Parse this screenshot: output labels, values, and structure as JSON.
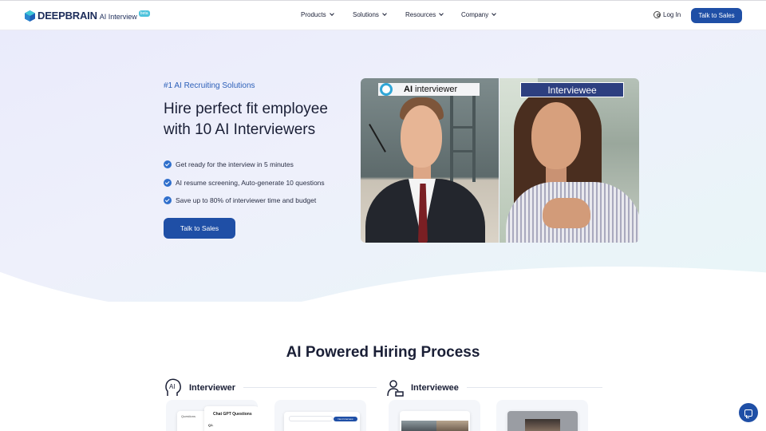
{
  "header": {
    "logo": {
      "brand": "DEEPBRAIN",
      "product": "AI Interview",
      "badge": "beta"
    },
    "nav": [
      {
        "label": "Products"
      },
      {
        "label": "Solutions"
      },
      {
        "label": "Resources"
      },
      {
        "label": "Company"
      }
    ],
    "login_label": "Log In",
    "cta_label": "Talk to Sales"
  },
  "hero": {
    "eyebrow": "#1 AI Recruiting Solutions",
    "title_line1": "Hire perfect fit employee",
    "title_line2": "with 10 AI Interviewers",
    "bullets": [
      "Get ready for the interview in 5 minutes",
      "AI resume screening, Auto-generate 10 questions",
      "Save up to 80% of interviewer time and budget"
    ],
    "cta_label": "Talk to Sales",
    "video": {
      "left_tag_bold": "AI",
      "left_tag_rest": "interviewer",
      "right_tag": "Interviewee"
    }
  },
  "process": {
    "title": "AI Powered Hiring Process",
    "interviewer_label": "Interviewer",
    "interviewer_icon_text": "AI",
    "interviewee_label": "Interviewee",
    "card1": {
      "header": "Questions",
      "chat_title": "Chat GPT Questions",
      "q_label": "Q1."
    },
    "card2": {
      "chip_label": "Next Interview"
    }
  },
  "colors": {
    "primary": "#1f4fa6",
    "accent_text": "#2b5fb8",
    "check": "#2f6fcc"
  }
}
